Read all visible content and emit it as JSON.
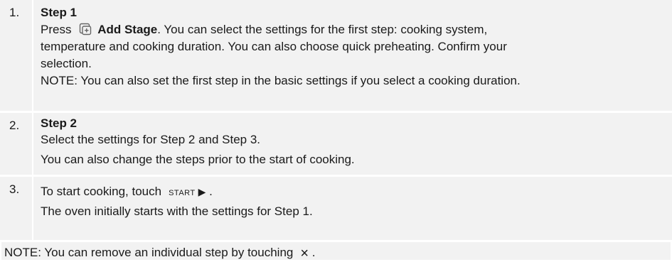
{
  "rows": [
    {
      "number": "1.",
      "title": "Step 1",
      "press_word": "Press",
      "icon": "add-stage-icon",
      "add_stage_label": "Add Stage",
      "text_after": ". You can select the settings for the first step: cooking system,",
      "lines": [
        "temperature and cooking duration. You can also choose quick preheating. Confirm your",
        "selection.",
        "NOTE: You can also set the first step in the basic settings if you select a cooking duration."
      ]
    },
    {
      "number": "2.",
      "title": "Step 2",
      "lines": [
        "Select the settings for Step 2 and Step 3.",
        "You can also change the steps prior to the start of cooking."
      ]
    },
    {
      "number": "3.",
      "text_before": "To start cooking, touch",
      "start_label": "START",
      "play_symbol": "▶",
      "text_after": ".",
      "lines": [
        "The oven initially starts with the settings for Step 1."
      ]
    }
  ],
  "note": {
    "text": "NOTE: You can remove an individual step by touching",
    "symbol": "×",
    "text_after": "."
  }
}
